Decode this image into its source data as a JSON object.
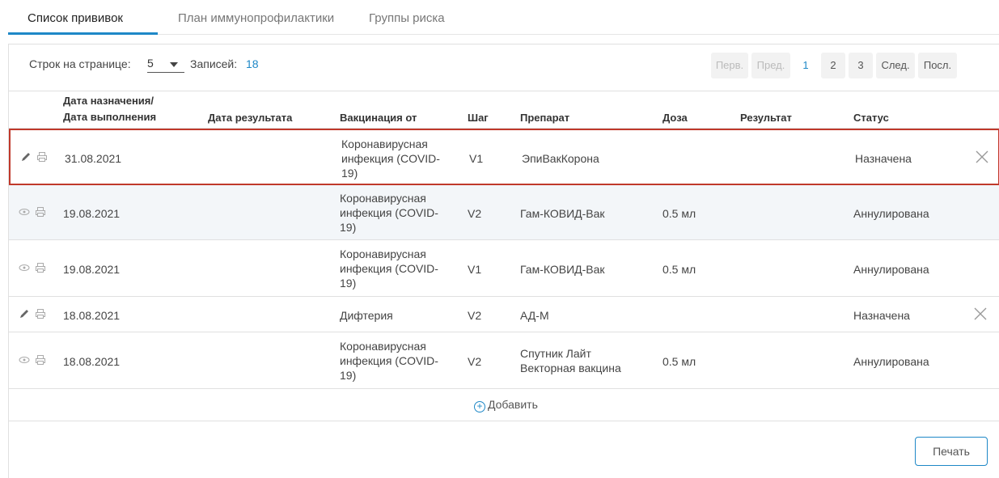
{
  "tabs": [
    {
      "label": "Список прививок",
      "active": true
    },
    {
      "label": "План иммунопрофилактики",
      "active": false
    },
    {
      "label": "Группы риска",
      "active": false
    }
  ],
  "toolbar": {
    "rows_label": "Строк на странице:",
    "rows_value": "5",
    "records_label": "Записей:",
    "records_count": "18"
  },
  "pager": {
    "first": "Перв.",
    "prev": "Пред.",
    "pages": [
      "1",
      "2",
      "3"
    ],
    "current_page": "1",
    "next": "След.",
    "last": "Посл."
  },
  "table": {
    "headers": {
      "date_line1": "Дата назначения/",
      "date_line2": "Дата выполнения",
      "result_date": "Дата результата",
      "vaccination": "Вакцинация от",
      "step": "Шаг",
      "drug": "Препарат",
      "dose": "Доза",
      "result": "Результат",
      "status": "Статус"
    },
    "rows": [
      {
        "action": "edit",
        "date": "31.08.2021",
        "result_date": "",
        "vac1": "Коронавирусная",
        "vac2": "инфекция (COVID-",
        "vac3": "19)",
        "step": "V1",
        "drug1": "ЭпиВакКорона",
        "drug2": "",
        "dose": "",
        "result": "",
        "status": "Назначена",
        "cancel": true,
        "selected": true
      },
      {
        "action": "view",
        "date": "19.08.2021",
        "result_date": "",
        "vac1": "Коронавирусная",
        "vac2": "инфекция (COVID-",
        "vac3": "19)",
        "step": "V2",
        "drug1": "Гам-КОВИД-Вак",
        "drug2": "",
        "dose": "0.5 мл",
        "result": "",
        "status": "Аннулирована",
        "cancel": false,
        "selected": false
      },
      {
        "action": "view",
        "date": "19.08.2021",
        "result_date": "",
        "vac1": "Коронавирусная",
        "vac2": "инфекция (COVID-",
        "vac3": "19)",
        "step": "V1",
        "drug1": "Гам-КОВИД-Вак",
        "drug2": "",
        "dose": "0.5 мл",
        "result": "",
        "status": "Аннулирована",
        "cancel": false,
        "selected": false
      },
      {
        "action": "edit",
        "date": "18.08.2021",
        "result_date": "",
        "vac1": "Дифтерия",
        "vac2": "",
        "vac3": "",
        "step": "V2",
        "drug1": "АД-М",
        "drug2": "",
        "dose": "",
        "result": "",
        "status": "Назначена",
        "cancel": true,
        "selected": false
      },
      {
        "action": "view",
        "date": "18.08.2021",
        "result_date": "",
        "vac1": "Коронавирусная",
        "vac2": "инфекция (COVID-",
        "vac3": "19)",
        "step": "V2",
        "drug1": "Спутник Лайт",
        "drug2": "Векторная вакцина",
        "dose": "0.5 мл",
        "result": "",
        "status": "Аннулирована",
        "cancel": false,
        "selected": false
      }
    ]
  },
  "add_label": "Добавить",
  "print_label": "Печать",
  "icons": {
    "edit": "pencil-icon",
    "view": "eye-icon",
    "print": "printer-icon",
    "cancel": "close-icon",
    "add": "plus-circle-icon"
  },
  "colors": {
    "accent": "#1e88c7",
    "selected_border": "#c0392b",
    "row_shade": "#f3f6f9"
  }
}
